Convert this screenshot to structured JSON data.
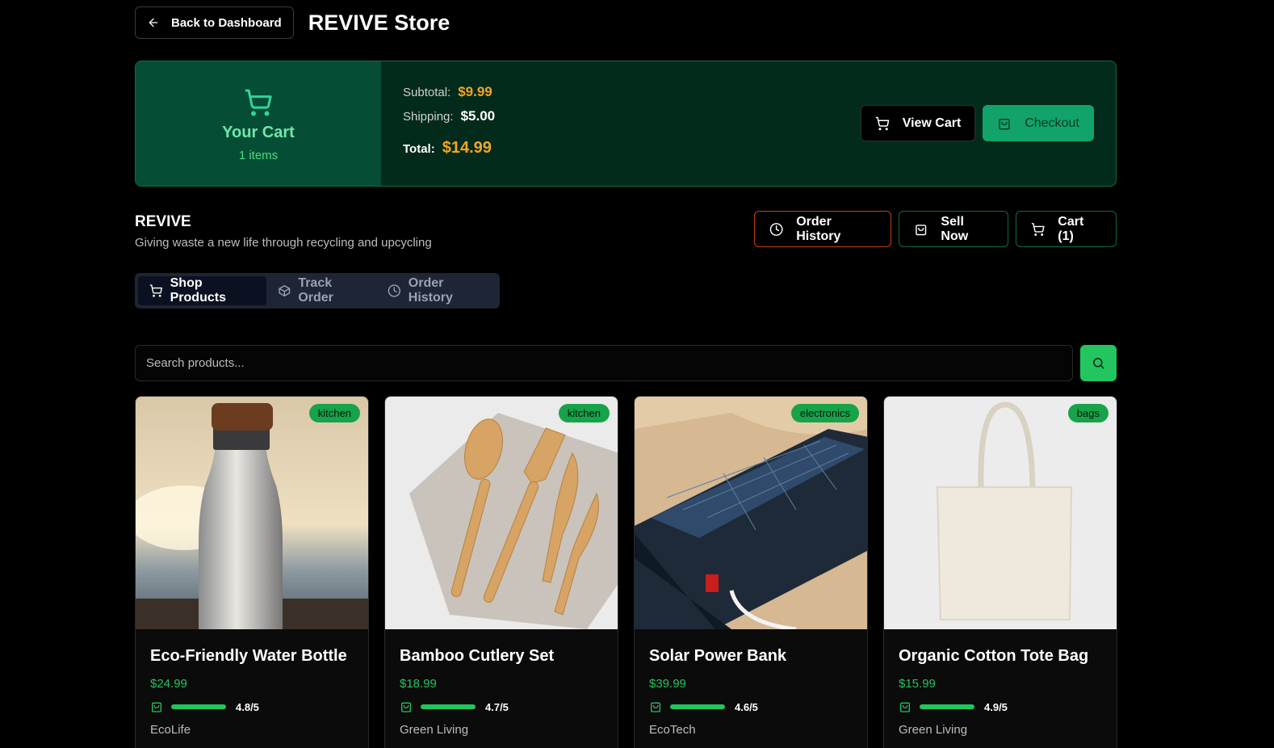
{
  "header": {
    "back_label": "Back to Dashboard",
    "title": "REVIVE Store"
  },
  "cart": {
    "title": "Your Cart",
    "count": "1 items",
    "subtotal_label": "Subtotal:",
    "subtotal": "$9.99",
    "shipping_label": "Shipping:",
    "shipping": "$5.00",
    "total_label": "Total:",
    "total": "$14.99",
    "view_label": "View Cart",
    "checkout_label": "Checkout"
  },
  "brand": {
    "name": "REVIVE",
    "tagline": "Giving waste a new life through recycling and upcycling"
  },
  "actions": {
    "history": "Order History",
    "sell": "Sell Now",
    "cart": "Cart (1)"
  },
  "tabs": [
    {
      "label": "Shop Products",
      "icon": "cart-icon"
    },
    {
      "label": "Track Order",
      "icon": "package-icon"
    },
    {
      "label": "Order History",
      "icon": "clock-icon"
    }
  ],
  "search": {
    "placeholder": "Search products..."
  },
  "products": [
    {
      "name": "Eco-Friendly Water Bottle",
      "price": "$24.99",
      "rating": "4.8/5",
      "rating_value": 4.8,
      "seller": "EcoLife",
      "category": "kitchen"
    },
    {
      "name": "Bamboo Cutlery Set",
      "price": "$18.99",
      "rating": "4.7/5",
      "rating_value": 4.7,
      "seller": "Green Living",
      "category": "kitchen"
    },
    {
      "name": "Solar Power Bank",
      "price": "$39.99",
      "rating": "4.6/5",
      "rating_value": 4.6,
      "seller": "EcoTech",
      "category": "electronics"
    },
    {
      "name": "Organic Cotton Tote Bag",
      "price": "$15.99",
      "rating": "4.9/5",
      "rating_value": 4.9,
      "seller": "Green Living",
      "category": "bags"
    }
  ],
  "colors": {
    "accent": "#22c55e",
    "price_orange": "#f5a524",
    "panel": "#032b1b"
  }
}
